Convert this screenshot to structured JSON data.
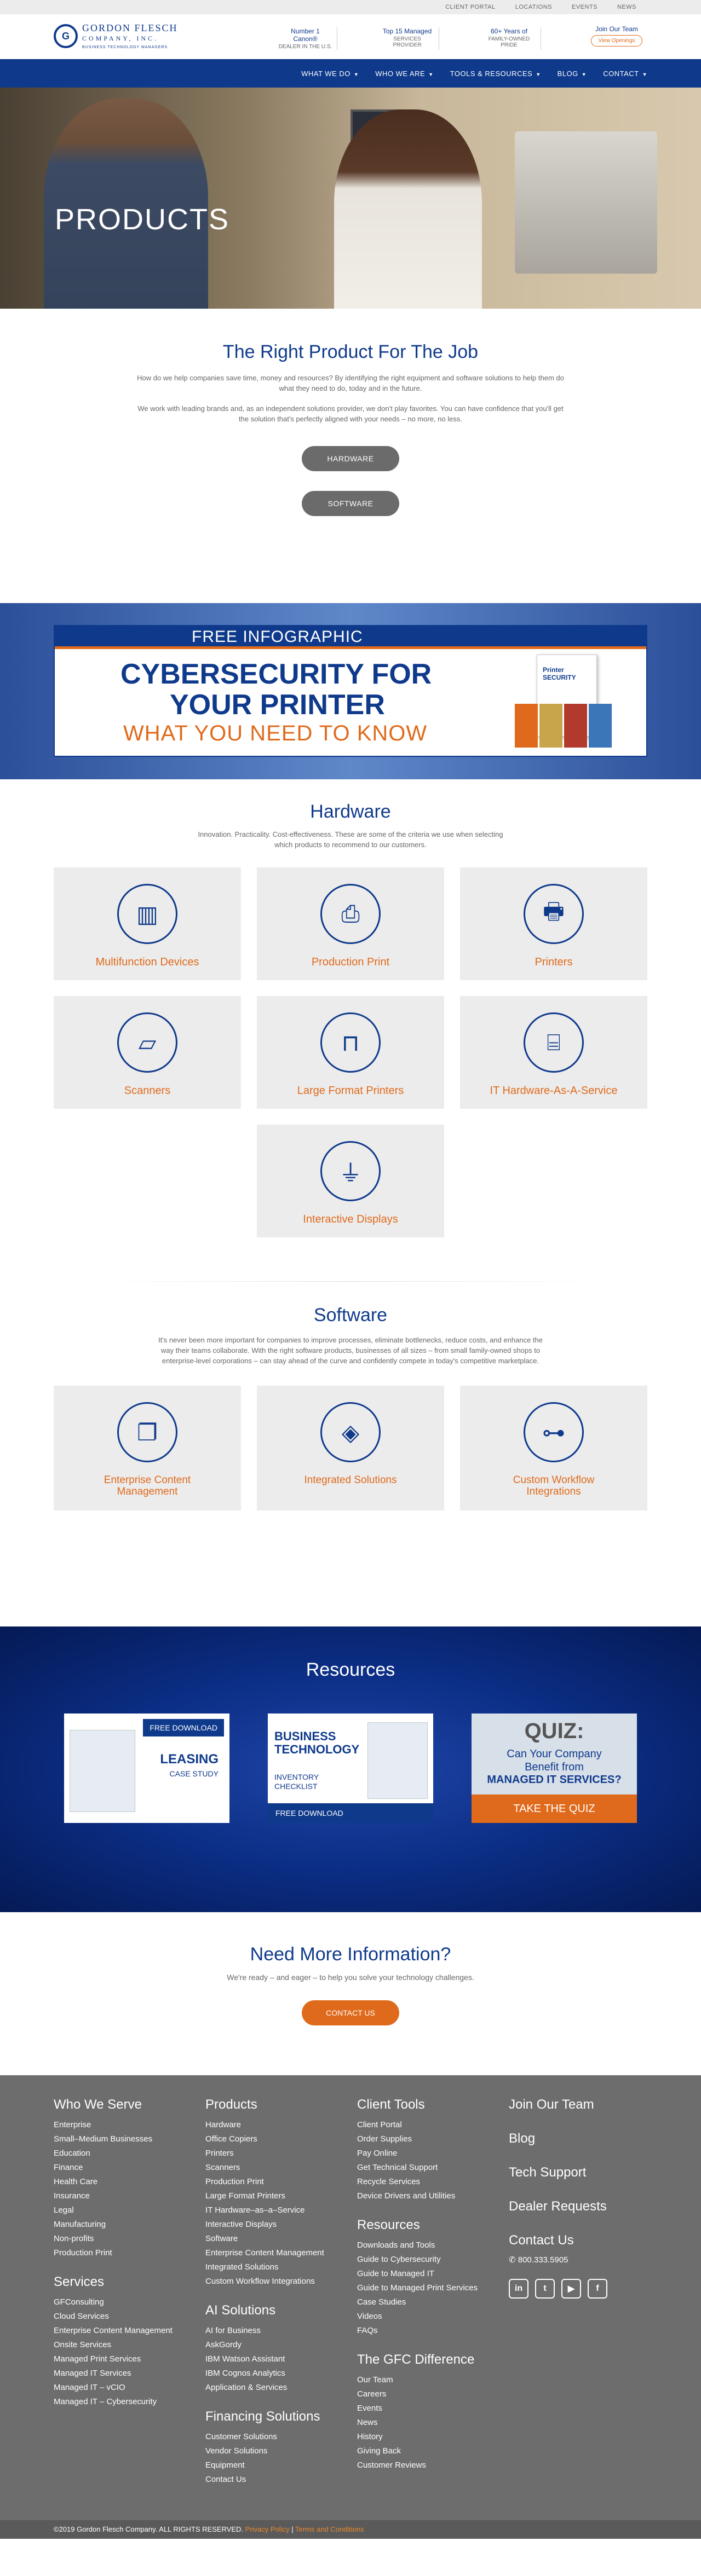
{
  "utility": [
    "CLIENT PORTAL",
    "LOCATIONS",
    "EVENTS",
    "NEWS"
  ],
  "logo": {
    "mark": "G",
    "name1": "GORDON FLESCH",
    "name2": "COMPANY, INC.",
    "sub": "BUSINESS TECHNOLOGY MANAGERS"
  },
  "header_stats": [
    {
      "b": "Number 1 Canon®",
      "s": "DEALER IN THE U.S."
    },
    {
      "b": "Top 15 Managed",
      "s": "SERVICES PROVIDER"
    },
    {
      "b": "60+ Years of",
      "s": "FAMILY-OWNED PRIDE"
    }
  ],
  "join": {
    "title": "Join Our Team",
    "button": "View Openings"
  },
  "nav": [
    "WHAT WE DO",
    "WHO WE ARE",
    "TOOLS & RESOURCES",
    "BLOG",
    "CONTACT"
  ],
  "hero": {
    "title": "PRODUCTS"
  },
  "intro": {
    "title": "The Right Product For The Job",
    "p1": "How do we help companies save time, money and resources? By identifying the right equipment and software solutions to help them do what they need to do, today and in the future.",
    "p2": "We work with leading brands and, as an independent solutions provider, we don't play favorites. You can have confidence that you'll get the solution that's perfectly aligned with your needs – no more, no less.",
    "btn1": "HARDWARE",
    "btn2": "SOFTWARE"
  },
  "infographic": {
    "bar": "FREE INFOGRAPHIC",
    "line1": "CYBERSECURITY FOR",
    "line2": "YOUR PRINTER",
    "line3": "WHAT YOU NEED TO KNOW",
    "doc_title": "Printer SECURITY"
  },
  "hardware": {
    "title": "Hardware",
    "lead": "Innovation. Practicality. Cost-effectiveness. These are some of the criteria we use when selecting which products to recommend to our customers.",
    "items": [
      {
        "label": "Multifunction Devices",
        "icon": "mfd-icon"
      },
      {
        "label": "Production Print",
        "icon": "production-print-icon"
      },
      {
        "label": "Printers",
        "icon": "printer-icon"
      },
      {
        "label": "Scanners",
        "icon": "scanner-icon"
      },
      {
        "label": "Large Format Printers",
        "icon": "large-format-printer-icon"
      },
      {
        "label": "IT Hardware-As-A-Service",
        "icon": "router-icon"
      },
      {
        "label": "Interactive Displays",
        "icon": "usb-icon"
      }
    ]
  },
  "software": {
    "title": "Software",
    "lead": "It's never been more important for companies to improve processes, eliminate bottlenecks, reduce costs, and enhance the way their teams collaborate. With the right software products, businesses of all sizes – from small family-owned shops to enterprise-level corporations – can stay ahead of the curve and confidently compete in today's competitive marketplace.",
    "items": [
      {
        "label": "Enterprise Content Management",
        "icon": "documents-icon"
      },
      {
        "label": "Integrated Solutions",
        "icon": "puzzle-icon"
      },
      {
        "label": "Custom Workflow Integrations",
        "icon": "workflow-icon"
      }
    ]
  },
  "resources": {
    "title": "Resources",
    "c1": {
      "dl": "FREE DOWNLOAD",
      "t": "LEASING",
      "s": "CASE STUDY"
    },
    "c2": {
      "t1": "BUSINESS",
      "t2": "TECHNOLOGY",
      "t3": "INVENTORY",
      "t4": "CHECKLIST",
      "dl": "FREE DOWNLOAD"
    },
    "c3": {
      "q": "QUIZ:",
      "l1": "Can Your Company",
      "l2": "Benefit from",
      "l3": "MANAGED IT SERVICES?",
      "btn": "TAKE THE QUIZ"
    }
  },
  "more": {
    "title": "Need More Information?",
    "p": "We're ready – and eager – to help you solve your technology challenges.",
    "btn": "CONTACT US"
  },
  "footer": {
    "serve": {
      "title": "Who We Serve",
      "items": [
        "Enterprise",
        "Small–Medium Businesses",
        "Education",
        "Finance",
        "Health Care",
        "Insurance",
        "Legal",
        "Manufacturing",
        "Non-profits",
        "Production Print"
      ]
    },
    "services": {
      "title": "Services",
      "items": [
        "GFConsulting",
        "Cloud Services",
        "Enterprise Content Management",
        "Onsite Services",
        "Managed Print Services",
        "Managed IT Services",
        "Managed IT – vCIO",
        "Managed IT – Cybersecurity"
      ]
    },
    "products": {
      "title": "Products",
      "items": [
        "Hardware",
        "Office Copiers",
        "Printers",
        "Scanners",
        "Production Print",
        "Large Format Printers",
        "IT Hardware–as–a–Service",
        "Interactive Displays",
        "Software",
        "Enterprise Content Management",
        "Integrated Solutions",
        "Custom Workflow Integrations"
      ]
    },
    "ai": {
      "title": "AI Solutions",
      "items": [
        "AI for Business",
        "AskGordy",
        "IBM Watson Assistant",
        "IBM Cognos Analytics",
        "Application & Services"
      ]
    },
    "financing": {
      "title": "Financing Solutions",
      "items": [
        "Customer Solutions",
        "Vendor Solutions",
        "Equipment",
        "Contact Us"
      ]
    },
    "tools": {
      "title": "Client Tools",
      "items": [
        "Client Portal",
        "Order Supplies",
        "Pay Online",
        "Get Technical Support",
        "Recycle Services",
        "Device Drivers and Utilities"
      ]
    },
    "res": {
      "title": "Resources",
      "items": [
        "Downloads and Tools",
        "Guide to Cybersecurity",
        "Guide to Managed IT",
        "Guide to Managed Print Services",
        "Case Studies",
        "Videos",
        "FAQs"
      ]
    },
    "gfc": {
      "title": "The GFC Difference",
      "items": [
        "Our Team",
        "Careers",
        "Events",
        "News",
        "History",
        "Giving Back",
        "Customer Reviews"
      ]
    },
    "links": [
      "Join Our Team",
      "Blog",
      "Tech Support",
      "Dealer Requests",
      "Contact Us"
    ],
    "phone": "800.333.5905"
  },
  "copyright": {
    "text": "©2019 Gordon Flesch Company. ALL RIGHTS RESERVED.",
    "privacy": "Privacy Policy",
    "sep": "|",
    "terms": "Terms and Conditions"
  }
}
